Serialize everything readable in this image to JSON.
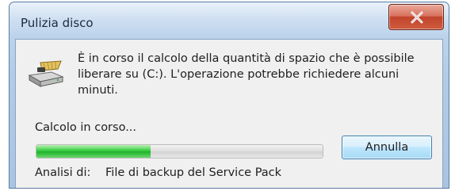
{
  "window": {
    "title": "Pulizia disco"
  },
  "dialog": {
    "message": "È in corso il calcolo della quantità di spazio che è possibile liberare su  (C:). L'operazione potrebbe richiedere alcuni minuti.",
    "status": "Calcolo in corso...",
    "progress_percent": 40,
    "cancel_label": "Annulla",
    "analysis_label": "Analisi di:",
    "analysis_value": "File di backup del Service Pack"
  },
  "icons": {
    "close": "close-icon",
    "disk": "disk-cleanup-icon"
  },
  "colors": {
    "progress_fill": "#1eb42a",
    "close_button": "#c1442c",
    "titlebar": "#b2cbe6"
  }
}
